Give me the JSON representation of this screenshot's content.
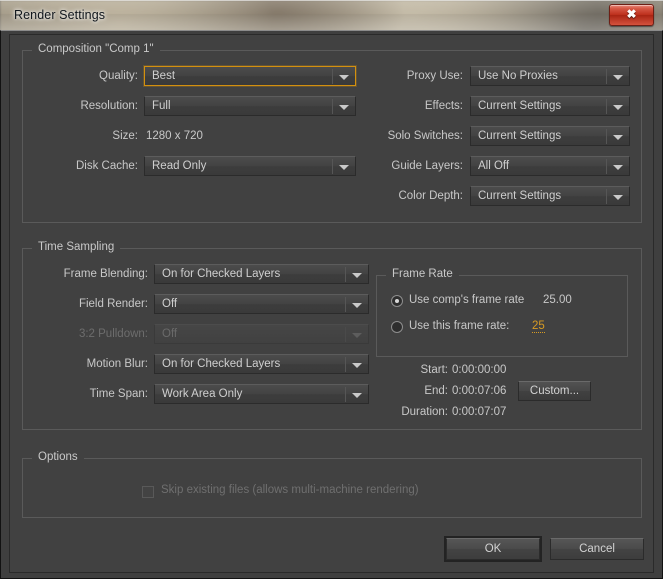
{
  "window": {
    "title": "Render Settings",
    "close_icon": "close-icon",
    "close_glyph": "✖"
  },
  "composition": {
    "legend": "Composition \"Comp 1\"",
    "left_fields": [
      {
        "label": "Quality:",
        "value": "Best",
        "focused": true,
        "disabled": false
      },
      {
        "label": "Resolution:",
        "value": "Full",
        "focused": false,
        "disabled": false
      }
    ],
    "size": {
      "label": "Size:",
      "value": "1280 x 720"
    },
    "disk_cache": {
      "label": "Disk Cache:",
      "value": "Read Only",
      "focused": false,
      "disabled": false
    },
    "right_fields": [
      {
        "label": "Proxy Use:",
        "value": "Use No Proxies",
        "focused": false,
        "disabled": false
      },
      {
        "label": "Effects:",
        "value": "Current Settings",
        "focused": false,
        "disabled": false
      },
      {
        "label": "Solo Switches:",
        "value": "Current Settings",
        "focused": false,
        "disabled": false
      },
      {
        "label": "Guide Layers:",
        "value": "All Off",
        "focused": false,
        "disabled": false
      },
      {
        "label": "Color Depth:",
        "value": "Current Settings",
        "focused": false,
        "disabled": false
      }
    ]
  },
  "time_sampling": {
    "legend": "Time Sampling",
    "fields": [
      {
        "label": "Frame Blending:",
        "value": "On for Checked Layers",
        "disabled": false
      },
      {
        "label": "Field Render:",
        "value": "Off",
        "disabled": false
      },
      {
        "label": "3:2 Pulldown:",
        "value": "Off",
        "disabled": true
      },
      {
        "label": "Motion Blur:",
        "value": "On for Checked Layers",
        "disabled": false
      },
      {
        "label": "Time Span:",
        "value": "Work Area Only",
        "disabled": false
      }
    ]
  },
  "frame_rate": {
    "legend": "Frame Rate",
    "use_comp_label": "Use comp's frame rate",
    "use_comp_value": "25.00",
    "use_comp_selected": true,
    "use_this_label": "Use this frame rate:",
    "use_this_value": "25",
    "use_this_selected": false
  },
  "time_info": {
    "start_label": "Start:",
    "start_value": "0:00:00:00",
    "end_label": "End:",
    "end_value": "0:00:07:06",
    "duration_label": "Duration:",
    "duration_value": "0:00:07:07",
    "custom_button": "Custom..."
  },
  "options": {
    "legend": "Options",
    "skip_existing_label": "Skip existing files (allows multi-machine rendering)",
    "skip_existing_checked": false,
    "skip_existing_disabled": true
  },
  "footer": {
    "ok_label": "OK",
    "cancel_label": "Cancel"
  },
  "colors": {
    "panel_bg": "#414141",
    "focus_orange": "#d3900f",
    "hot_text": "#d79b23",
    "label_text": "#c8c8c8",
    "disabled_text": "#6d6d6d",
    "close_red": "#bc2e1b"
  }
}
